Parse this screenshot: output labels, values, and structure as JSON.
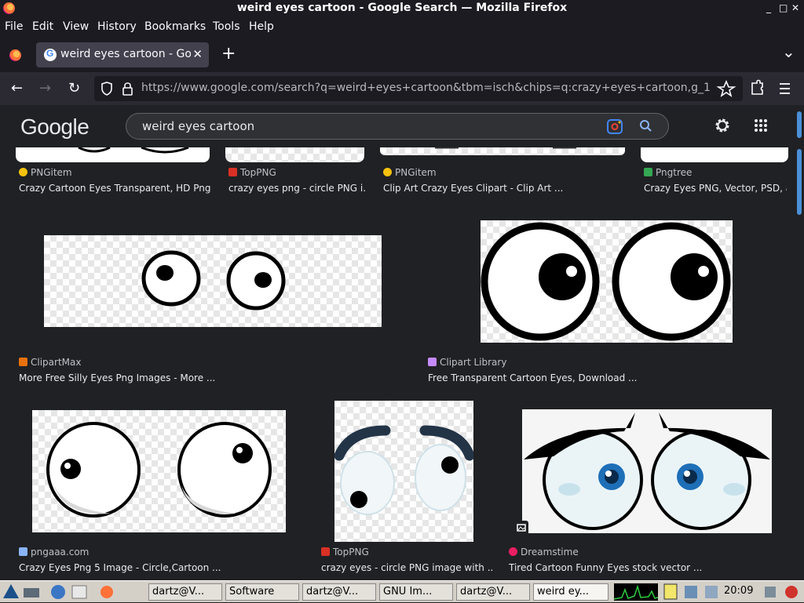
{
  "window": {
    "title": "weird eyes cartoon - Google Search — Mozilla Firefox",
    "minimize": "_",
    "maximize": "□",
    "close": "✕"
  },
  "menu": [
    "File",
    "Edit",
    "View",
    "History",
    "Bookmarks",
    "Tools",
    "Help"
  ],
  "tab": {
    "label": "weird eyes cartoon - Goo",
    "close": "✕",
    "new": "+",
    "list": "⌄"
  },
  "nav": {
    "back": "←",
    "forward": "→",
    "reload": "↻",
    "url": "https://www.google.com/search?q=weird+eyes+cartoon&tbm=isch&chips=q:crazy+eyes+cartoon,g_1"
  },
  "google": {
    "logo": "Google",
    "query": "weird eyes cartoon"
  },
  "results": [
    {
      "source": "PNGitem",
      "caption": "Crazy Cartoon Eyes Transparent, HD Png ...",
      "icon_color": "#f4c20d"
    },
    {
      "source": "TopPNG",
      "caption": "crazy eyes png - circle PNG i...",
      "icon_color": "#d93025"
    },
    {
      "source": "PNGitem",
      "caption": "Clip Art Crazy Eyes Clipart - Clip Art ...",
      "icon_color": "#f4c20d"
    },
    {
      "source": "Pngtree",
      "caption": "Crazy Eyes PNG, Vector, PSD, a...",
      "icon_color": "#34a853"
    },
    {
      "source": "ClipartMax",
      "caption": "More Free Silly Eyes Png Images - More ...",
      "icon_color": "#e8710a"
    },
    {
      "source": "Clipart Library",
      "caption": "Free Transparent Cartoon Eyes, Download ...",
      "icon_color": "#c58af9"
    },
    {
      "source": "pngaaa.com",
      "caption": "Crazy Eyes Png 5 Image - Circle,Cartoon ...",
      "icon_color": "#8ab4f8"
    },
    {
      "source": "TopPNG",
      "caption": "crazy eyes - circle PNG image with ...",
      "icon_color": "#d93025"
    },
    {
      "source": "Dreamstime",
      "caption": "Tired Cartoon Funny Eyes stock vector ...",
      "icon_color": "#e91e63"
    }
  ],
  "taskbar": {
    "items": [
      "dartz@V...",
      "Software",
      "dartz@V...",
      "GNU Im...",
      "dartz@V...",
      "weird ey..."
    ],
    "clock": "20:09"
  }
}
